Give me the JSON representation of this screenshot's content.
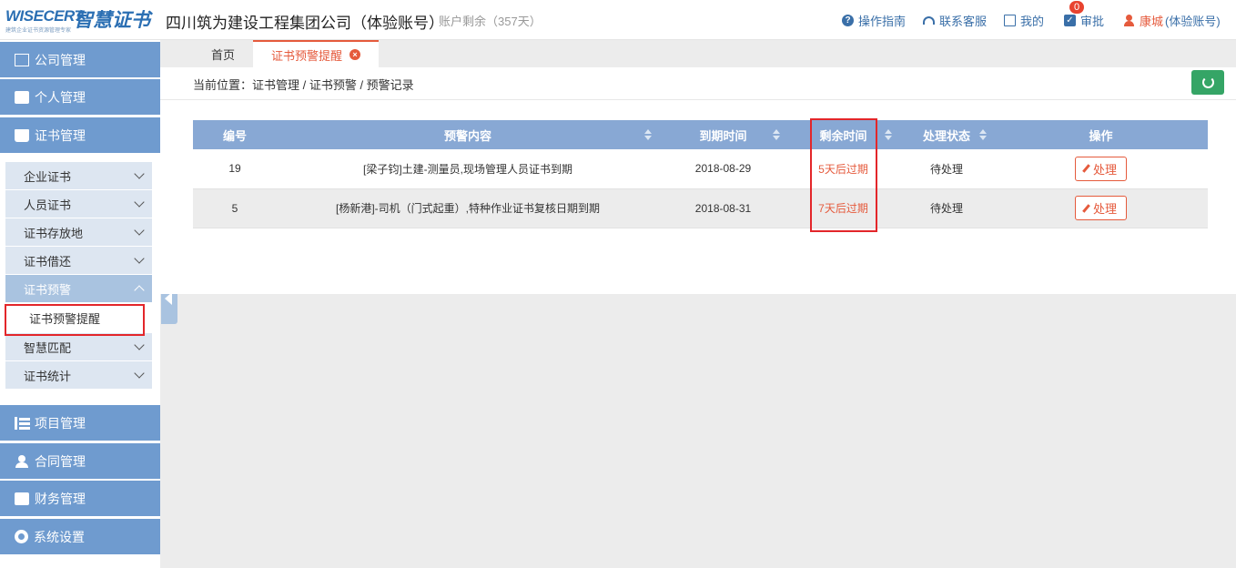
{
  "header": {
    "logo_en": "WISECERT",
    "logo_cn": "智慧证书",
    "logo_sub": "建筑企业证书资源管理专家",
    "company": "四川筑为建设工程集团公司（体验账号）",
    "remain": "账户剩余（357天）",
    "nav": {
      "guide": "操作指南",
      "service": "联系客服",
      "mine": "我的",
      "approve": "审批",
      "approve_badge": "0",
      "user": "康城",
      "user_suffix": "(体验账号)"
    }
  },
  "sidebar": {
    "main": [
      {
        "label": "公司管理"
      },
      {
        "label": "个人管理"
      },
      {
        "label": "证书管理"
      },
      {
        "label": "项目管理"
      },
      {
        "label": "合同管理"
      },
      {
        "label": "财务管理"
      },
      {
        "label": "系统设置"
      }
    ],
    "sub": {
      "qiye": "企业证书",
      "renyuan": "人员证书",
      "cunfang": "证书存放地",
      "jiehuan": "证书借还",
      "yujing": "证书预警",
      "yujing_leaf": "证书预警提醒",
      "pipei": "智慧匹配",
      "tongji": "证书统计"
    }
  },
  "tabs": {
    "home": "首页",
    "active": "证书预警提醒"
  },
  "breadcrumb": "当前位置：证书管理 / 证书预警 / 预警记录",
  "table": {
    "headers": {
      "id": "编号",
      "content": "预警内容",
      "expire": "到期时间",
      "remaining": "剩余时间",
      "status": "处理状态",
      "action": "操作"
    },
    "rows": [
      {
        "id": "19",
        "content": "[梁子钧]土建-测量员,现场管理人员证书到期",
        "expire": "2018-08-29",
        "remaining": "5天后过期",
        "status": "待处理",
        "action": "处理"
      },
      {
        "id": "5",
        "content": "[杨新港]-司机（门式起重）,特种作业证书复核日期到期",
        "expire": "2018-08-31",
        "remaining": "7天后过期",
        "status": "待处理",
        "action": "处理"
      }
    ]
  },
  "colors": {
    "sidebar_main": "#6f9bcf",
    "table_header": "#88a8d4",
    "accent": "#e55a3c",
    "highlight": "#e3262a",
    "refresh": "#35a566"
  }
}
